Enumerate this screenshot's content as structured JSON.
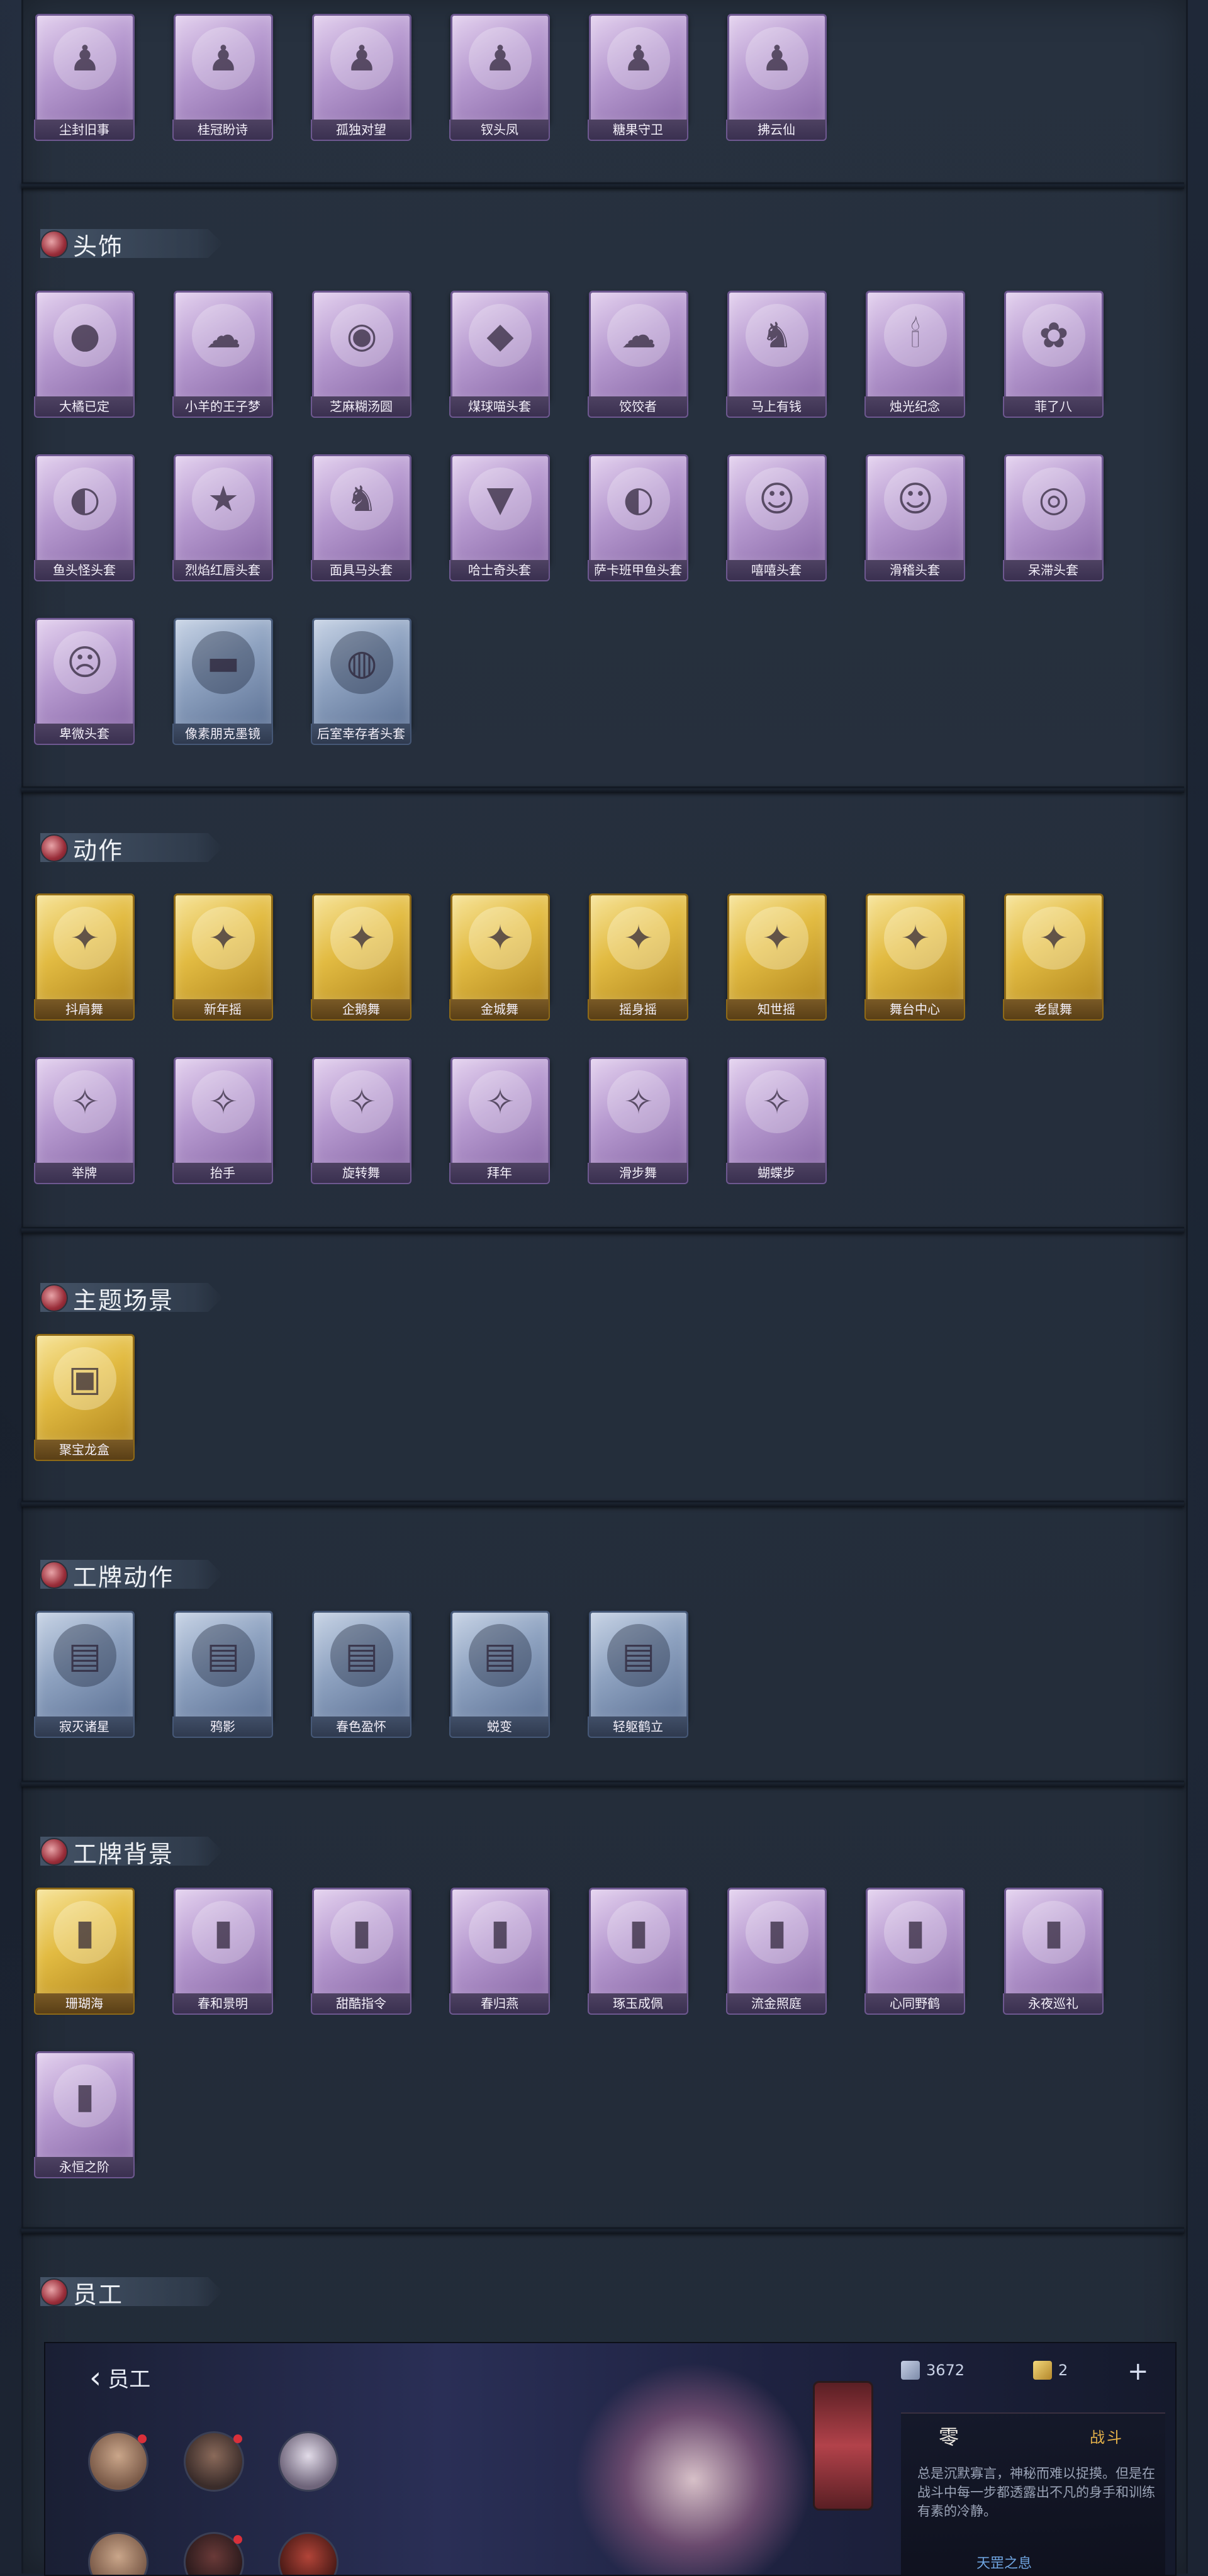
{
  "sections": {
    "top": {
      "items": [
        {
          "label": "尘封旧事",
          "icon": "figure-icon",
          "tier": "purple"
        },
        {
          "label": "桂冠盼诗",
          "icon": "figure-icon",
          "tier": "purple"
        },
        {
          "label": "孤独对望",
          "icon": "figure-icon",
          "tier": "purple"
        },
        {
          "label": "钗头凤",
          "icon": "figure-icon",
          "tier": "purple"
        },
        {
          "label": "糖果守卫",
          "icon": "figure-icon",
          "tier": "purple"
        },
        {
          "label": "拂云仙",
          "icon": "figure-icon",
          "tier": "purple"
        }
      ]
    },
    "headwear": {
      "title": "头饰",
      "items": [
        {
          "label": "大橘已定",
          "icon": "orange-head-icon",
          "tier": "purple"
        },
        {
          "label": "小羊的王子梦",
          "icon": "sheep-head-icon",
          "tier": "purple"
        },
        {
          "label": "芝麻糊汤圆",
          "icon": "dumpling-head-icon",
          "tier": "purple"
        },
        {
          "label": "煤球喵头套",
          "icon": "cat-head-icon",
          "tier": "purple"
        },
        {
          "label": "饺饺者",
          "icon": "cloud-head-icon",
          "tier": "purple"
        },
        {
          "label": "马上有钱",
          "icon": "horse-head-icon",
          "tier": "purple"
        },
        {
          "label": "烛光纪念",
          "icon": "candle-head-icon",
          "tier": "purple"
        },
        {
          "label": "菲了八",
          "icon": "radish-head-icon",
          "tier": "purple"
        },
        {
          "label": "鱼头怪头套",
          "icon": "fish-head-icon",
          "tier": "purple"
        },
        {
          "label": "烈焰红唇头套",
          "icon": "pikachu-head-icon",
          "tier": "purple"
        },
        {
          "label": "面具马头套",
          "icon": "horse-mask-icon",
          "tier": "purple"
        },
        {
          "label": "哈士奇头套",
          "icon": "husky-head-icon",
          "tier": "purple"
        },
        {
          "label": "萨卡班甲鱼头套",
          "icon": "fish-head-icon",
          "tier": "purple"
        },
        {
          "label": "嘻嘻头套",
          "icon": "grin-emoji-icon",
          "tier": "purple"
        },
        {
          "label": "滑稽头套",
          "icon": "smirk-emoji-icon",
          "tier": "purple"
        },
        {
          "label": "呆滞头套",
          "icon": "dazed-emoji-icon",
          "tier": "purple"
        },
        {
          "label": "卑微头套",
          "icon": "sad-emoji-icon",
          "tier": "purple"
        },
        {
          "label": "像素朋克墨镜",
          "icon": "pixel-sunglasses-icon",
          "tier": "blue"
        },
        {
          "label": "后室幸存者头套",
          "icon": "gasmask-icon",
          "tier": "blue"
        }
      ]
    },
    "actions": {
      "title": "动作",
      "items": [
        {
          "label": "抖肩舞",
          "icon": "dance-icon",
          "tier": "gold"
        },
        {
          "label": "新年摇",
          "icon": "dance-icon",
          "tier": "gold"
        },
        {
          "label": "企鹅舞",
          "icon": "dance-icon",
          "tier": "gold"
        },
        {
          "label": "金城舞",
          "icon": "dance-icon",
          "tier": "gold"
        },
        {
          "label": "摇身摇",
          "icon": "dance-icon",
          "tier": "gold"
        },
        {
          "label": "知世摇",
          "icon": "dance-icon",
          "tier": "gold"
        },
        {
          "label": "舞台中心",
          "icon": "dance-icon",
          "tier": "gold"
        },
        {
          "label": "老鼠舞",
          "icon": "dance-icon",
          "tier": "gold"
        },
        {
          "label": "举牌",
          "icon": "pose-icon",
          "tier": "purple"
        },
        {
          "label": "抬手",
          "icon": "pose-icon",
          "tier": "purple"
        },
        {
          "label": "旋转舞",
          "icon": "pose-icon",
          "tier": "purple"
        },
        {
          "label": "拜年",
          "icon": "pose-icon",
          "tier": "purple"
        },
        {
          "label": "滑步舞",
          "icon": "pose-icon",
          "tier": "purple"
        },
        {
          "label": "蝴蝶步",
          "icon": "pose-icon",
          "tier": "purple"
        }
      ]
    },
    "scene": {
      "title": "主题场景",
      "items": [
        {
          "label": "聚宝龙盒",
          "icon": "scene-icon",
          "tier": "gold"
        }
      ]
    },
    "badge_actions": {
      "title": "工牌动作",
      "items": [
        {
          "label": "寂灭诸星",
          "icon": "badge-pose-icon",
          "tier": "blue"
        },
        {
          "label": "鸦影",
          "icon": "badge-pose-icon",
          "tier": "blue"
        },
        {
          "label": "春色盈怀",
          "icon": "badge-pose-icon",
          "tier": "blue"
        },
        {
          "label": "蜕变",
          "icon": "badge-pose-icon",
          "tier": "blue"
        },
        {
          "label": "轻躯鹤立",
          "icon": "badge-pose-icon",
          "tier": "blue"
        }
      ]
    },
    "badge_backgrounds": {
      "title": "工牌背景",
      "items": [
        {
          "label": "珊瑚海",
          "icon": "card-icon",
          "tier": "gold"
        },
        {
          "label": "春和景明",
          "icon": "card-icon",
          "tier": "purple"
        },
        {
          "label": "甜酷指令",
          "icon": "card-icon",
          "tier": "purple"
        },
        {
          "label": "春归燕",
          "icon": "card-icon",
          "tier": "purple"
        },
        {
          "label": "琢玉成佩",
          "icon": "card-icon",
          "tier": "purple"
        },
        {
          "label": "流金照庭",
          "icon": "card-icon",
          "tier": "purple"
        },
        {
          "label": "心同野鹤",
          "icon": "card-icon",
          "tier": "purple"
        },
        {
          "label": "永夜巡礼",
          "icon": "card-icon",
          "tier": "purple"
        },
        {
          "label": "永恒之阶",
          "icon": "card-icon",
          "tier": "purple"
        }
      ]
    },
    "staff": {
      "title": "员工"
    }
  },
  "staff_panel": {
    "back_label": "员工",
    "currency_a": "3672",
    "currency_b": "2",
    "plus": "+",
    "char_name": "零",
    "char_tag": "战斗",
    "char_desc": "总是沉默寡言，神秘而难以捉摸。但是在战斗中每一步都透露出不凡的身手和训练有素的冷静。",
    "char_sub": "天罡之息"
  },
  "colors": {
    "purple_tier": "#b79ad0",
    "gold_tier": "#e2bb42",
    "blue_tier": "#8ea2c0",
    "accent_red": "#d9303a"
  }
}
